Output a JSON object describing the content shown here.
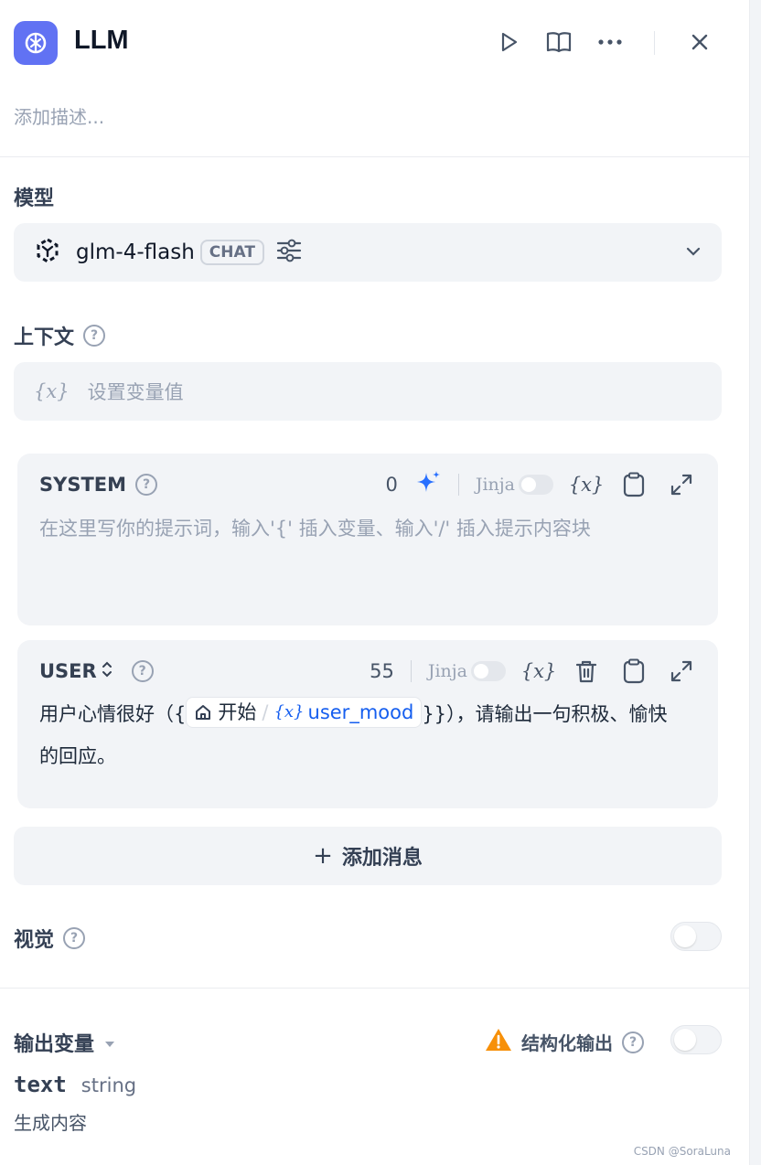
{
  "header": {
    "title": "LLM"
  },
  "description_placeholder": "添加描述...",
  "model": {
    "label": "模型",
    "name": "glm-4-flash",
    "mode_badge": "CHAT"
  },
  "context": {
    "label": "上下文",
    "var_icon": "{x}",
    "placeholder": "设置变量值"
  },
  "system": {
    "role": "SYSTEM",
    "count": "0",
    "jinja": "Jinja",
    "var_icon": "{x}",
    "placeholder": "在这里写你的提示词，输入'{' 插入变量、输入'/' 插入提示内容块"
  },
  "user": {
    "role": "USER",
    "count": "55",
    "jinja": "Jinja",
    "var_icon": "{x}",
    "text_before": "用户心情很好（{",
    "chip_node": "开始",
    "chip_sep": "/",
    "chip_var_icon": "{x}",
    "chip_var": "user_mood",
    "text_after": "}}），请输出一句积极、愉快的回应。"
  },
  "add_message": {
    "plus": "+",
    "label": "添加消息"
  },
  "vision": {
    "label": "视觉"
  },
  "output": {
    "label": "输出变量",
    "structured_label": "结构化输出",
    "var_name": "text",
    "var_type": "string",
    "var_desc": "生成内容"
  },
  "watermark": "CSDN @SoraLuna",
  "colors": {
    "accent": "#6172f3",
    "link": "#155eef",
    "warning": "#f79009"
  }
}
